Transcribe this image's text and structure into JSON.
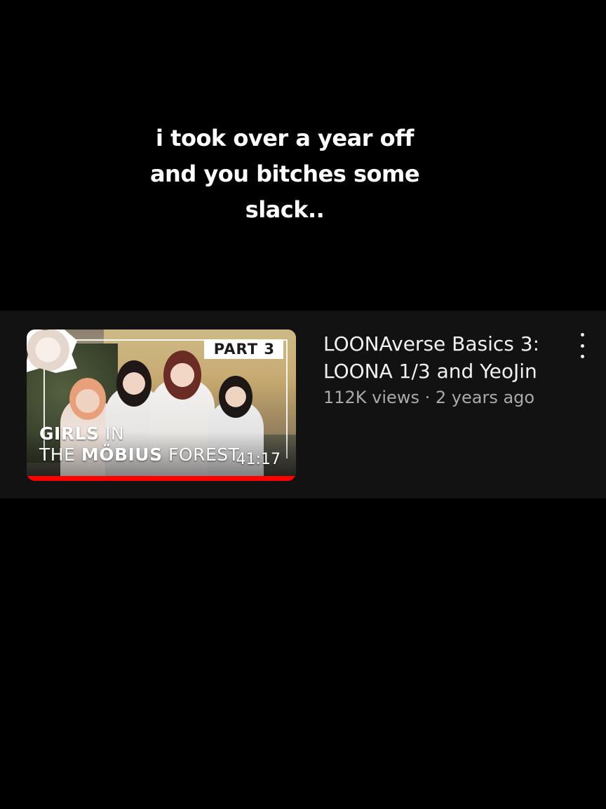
{
  "overlay_caption": {
    "lines": [
      "i took over a year off",
      "and you bitches some",
      "slack.."
    ]
  },
  "video": {
    "thumbnail": {
      "part_label": "PART  3",
      "title_line1_bold": "GIRLS",
      "title_line1_rest": " IN",
      "title_line2_plain": "THE ",
      "title_line2_bold": "MÖBIUS",
      "title_line2_rest": " FOREST",
      "duration": "41:17",
      "watch_progress": 1.0,
      "progress_color": "#ff0000"
    },
    "title": "LOONAverse Basics 3: LOONA 1/3 and YeoJin",
    "views": "112K views",
    "separator": "·",
    "age": "2 years ago",
    "more_icon": "more-vertical-icon"
  },
  "colors": {
    "background": "#000000",
    "card_background": "#121212",
    "title_text": "#f1f1f1",
    "meta_text": "#aaaaaa"
  }
}
